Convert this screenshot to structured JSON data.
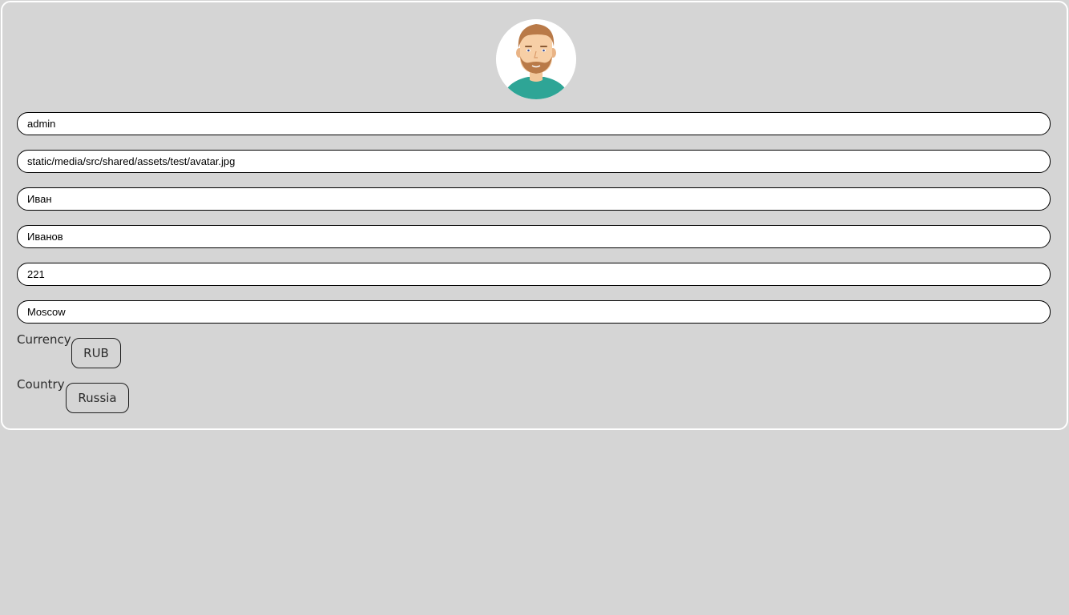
{
  "profile": {
    "avatar_icon": "user-avatar-icon",
    "fields": {
      "username": "admin",
      "avatar_path": "static/media/src/shared/assets/test/avatar.jpg",
      "first_name": "Иван",
      "last_name": "Иванов",
      "age": "221",
      "city": "Moscow"
    },
    "currency": {
      "label": "Currency",
      "value": "RUB"
    },
    "country": {
      "label": "Country",
      "value": "Russia"
    }
  },
  "colors": {
    "background": "#d5d5d5",
    "card_border": "#ffffff",
    "input_background": "#ffffff",
    "input_border": "#000000",
    "avatar_shirt": "#2ea596",
    "avatar_hair": "#b97a48"
  }
}
